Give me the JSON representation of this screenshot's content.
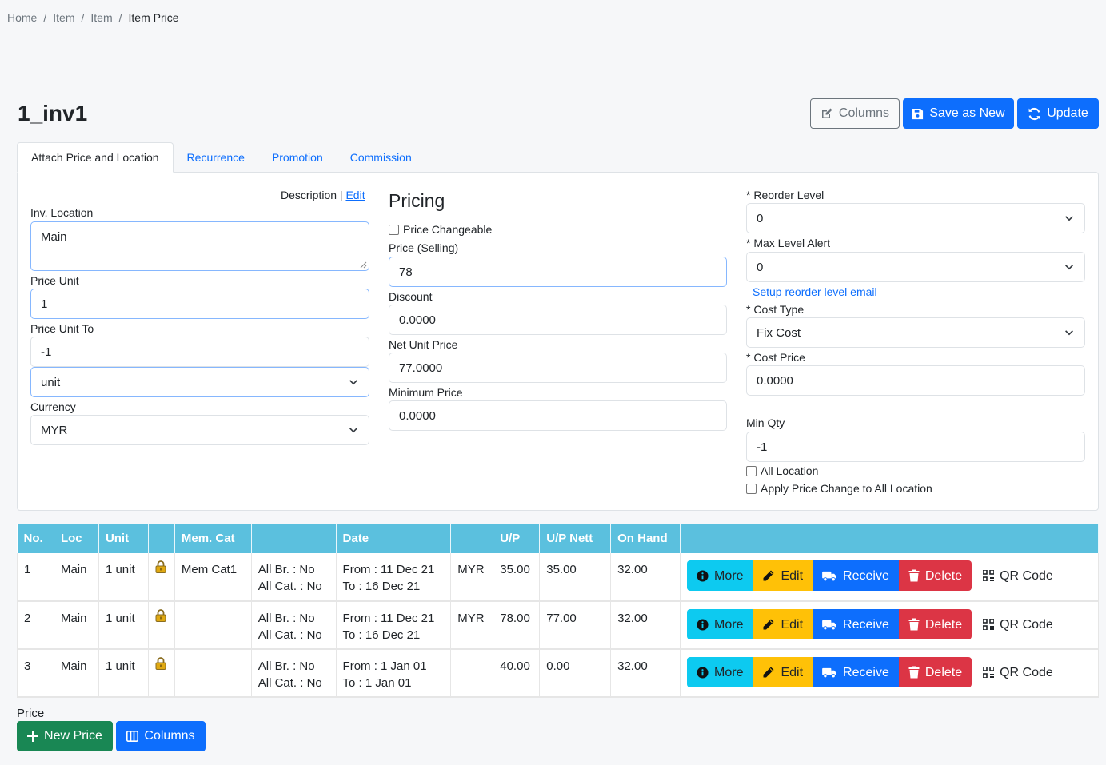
{
  "breadcrumb": [
    "Home",
    "Item",
    "Item",
    "Item Price"
  ],
  "page": {
    "title": "1_inv1"
  },
  "toolbar": {
    "columns_label": "Columns",
    "save_as_new_label": "Save as New",
    "update_label": "Update"
  },
  "tabs": [
    "Attach Price and Location",
    "Recurrence",
    "Promotion",
    "Commission"
  ],
  "form": {
    "description_label": "Description",
    "description_sep": "|",
    "description_edit": "Edit",
    "inv_location_label": "Inv. Location",
    "inv_location_value": "Main",
    "price_unit_label": "Price Unit",
    "price_unit_value": "1",
    "price_unit_to_label": "Price Unit To",
    "price_unit_to_value": "-1",
    "unit_select_value": "unit",
    "currency_label": "Currency",
    "currency_value": "MYR",
    "pricing_heading": "Pricing",
    "price_changeable_label": "Price Changeable",
    "price_selling_label": "Price (Selling)",
    "price_selling_value": "78",
    "discount_label": "Discount",
    "discount_value": "0.0000",
    "net_unit_price_label": "Net Unit Price",
    "net_unit_price_value": "77.0000",
    "minimum_price_label": "Minimum Price",
    "minimum_price_value": "0.0000",
    "reorder_level_label": "* Reorder Level",
    "reorder_level_value": "0",
    "max_level_alert_label": "* Max Level Alert",
    "max_level_alert_value": "0",
    "setup_reorder_link": "Setup reorder level email",
    "cost_type_label": "* Cost Type",
    "cost_type_value": "Fix Cost",
    "cost_price_label": "* Cost Price",
    "cost_price_value": "0.0000",
    "min_qty_label": "Min Qty",
    "min_qty_value": "-1",
    "all_location_label": "All Location",
    "apply_all_label": "Apply Price Change to All Location"
  },
  "table": {
    "headers": [
      "No.",
      "Loc",
      "Unit",
      "",
      "Mem. Cat",
      "",
      "Date",
      "",
      "U/P",
      "U/P Nett",
      "On Hand",
      ""
    ],
    "rows": [
      {
        "no": "1",
        "loc": "Main",
        "unit": "1 unit",
        "mem_cat": "Mem Cat1",
        "br": "All Br. : No",
        "cat": "All Cat. : No",
        "from": "From : 11 Dec 21",
        "to": "To : 16 Dec 21",
        "cur": "MYR",
        "up": "35.00",
        "up_nett": "35.00",
        "on_hand": "32.00"
      },
      {
        "no": "2",
        "loc": "Main",
        "unit": "1 unit",
        "mem_cat": "",
        "br": "All Br. : No",
        "cat": "All Cat. : No",
        "from": "From : 11 Dec 21",
        "to": "To : 16 Dec 21",
        "cur": "MYR",
        "up": "78.00",
        "up_nett": "77.00",
        "on_hand": "32.00"
      },
      {
        "no": "3",
        "loc": "Main",
        "unit": "1 unit",
        "mem_cat": "",
        "br": "All Br. : No",
        "cat": "All Cat. : No",
        "from": "From : 1 Jan 01",
        "to": "To : 1 Jan 01",
        "cur": "",
        "up": "40.00",
        "up_nett": "0.00",
        "on_hand": "32.00"
      }
    ],
    "actions": {
      "more": "More",
      "edit": "Edit",
      "receive": "Receive",
      "delete": "Delete",
      "qr": "QR Code"
    }
  },
  "footer": {
    "price_label": "Price",
    "new_price_label": "New Price",
    "columns_label": "Columns"
  },
  "colors": {
    "primary": "#0d6efd",
    "info": "#0dcaf0",
    "warning": "#ffc107",
    "danger": "#dc3545",
    "success": "#198754",
    "table_header": "#5bc0de"
  }
}
